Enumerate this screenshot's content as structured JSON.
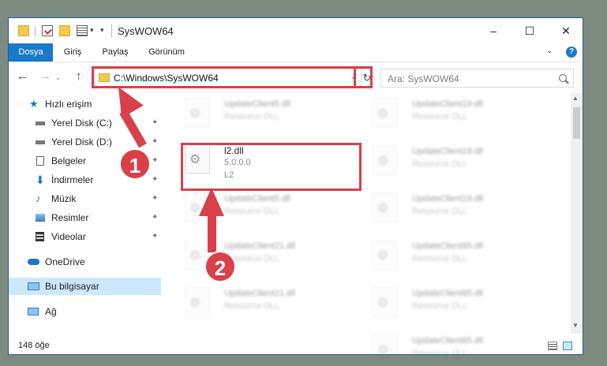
{
  "window": {
    "title": "SysWOW64",
    "min_glyph": "–",
    "max_glyph": "☐",
    "close_glyph": "✕"
  },
  "ribbon": {
    "tabs": [
      "Dosya",
      "Giriş",
      "Paylaş",
      "Görünüm"
    ],
    "expand_glyph": "⌄",
    "help_label": "?"
  },
  "nav": {
    "back_glyph": "←",
    "forward_glyph": "→",
    "history_glyph": "⌄",
    "up_glyph": "↑",
    "address": "C:\\Windows\\SysWOW64",
    "address_drop": "⌄",
    "refresh_glyph": "↻",
    "search_placeholder": "Ara: SysWOW64"
  },
  "sidebar": {
    "items": [
      {
        "label": "Hızlı erişim",
        "icon": "star-icon",
        "pinned": false
      },
      {
        "label": "Yerel Disk (C:)",
        "icon": "drive-icon",
        "pinned": true
      },
      {
        "label": "Yerel Disk (D:)",
        "icon": "drive-icon",
        "pinned": true
      },
      {
        "label": "Belgeler",
        "icon": "document-icon",
        "pinned": true
      },
      {
        "label": "İndirmeler",
        "icon": "download-icon",
        "pinned": true
      },
      {
        "label": "Müzik",
        "icon": "music-icon",
        "pinned": true
      },
      {
        "label": "Resimler",
        "icon": "picture-icon",
        "pinned": true
      },
      {
        "label": "Videolar",
        "icon": "video-icon",
        "pinned": true
      },
      {
        "label": "OneDrive",
        "icon": "cloud-icon",
        "pinned": false
      },
      {
        "label": "Bu bilgisayar",
        "icon": "computer-icon",
        "pinned": false
      },
      {
        "label": "Ağ",
        "icon": "network-icon",
        "pinned": false
      }
    ],
    "pin_glyph": "📌"
  },
  "files": {
    "left_col": [
      {
        "name": "UpdateClient5.dll",
        "desc": "Resource DLL"
      },
      {
        "name": "UpdateClient5.dll",
        "desc": "Resource DLL"
      },
      {
        "name": "UpdateClient21.dll",
        "desc": "Resource DLL"
      },
      {
        "name": "UpdateClient21.dll",
        "desc": "Resource DLL"
      }
    ],
    "right_col": [
      {
        "name": "UpdateClient19.dll",
        "desc": "Resource DLL"
      },
      {
        "name": "UpdateClient19.dll",
        "desc": "Resource DLL"
      },
      {
        "name": "UpdateClient19.dll",
        "desc": "Resource DLL"
      },
      {
        "name": "UpdateClient65.dll",
        "desc": "Resource DLL"
      },
      {
        "name": "UpdateClient65.dll",
        "desc": "Resource DLL"
      },
      {
        "name": "UpdateClient65.dll",
        "desc": "Resource DLL"
      }
    ],
    "selected": {
      "name": "l2.dll",
      "version": "5.0.0.0",
      "desc": "L2"
    }
  },
  "status": {
    "count": "148 öğe"
  },
  "annotations": {
    "badge1": "1",
    "badge2": "2",
    "color": "#d9404a"
  }
}
